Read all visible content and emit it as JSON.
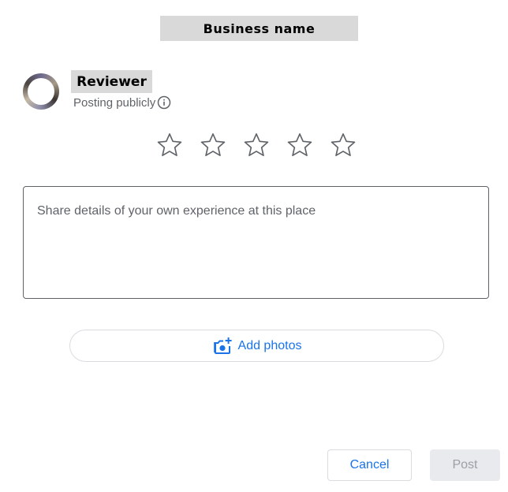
{
  "header": {
    "business_name": "Business name"
  },
  "author": {
    "name": "Reviewer",
    "posting_text": "Posting publicly"
  },
  "rating": {
    "max": 5,
    "selected": 0,
    "star_icon": "star-outline-icon",
    "star_color": "#5f6368"
  },
  "review": {
    "placeholder": "Share details of your own experience at this place"
  },
  "photos": {
    "label": "Add photos",
    "icon": "add-photo-icon",
    "color": "#1a73e8"
  },
  "actions": {
    "cancel_label": "Cancel",
    "post_label": "Post"
  }
}
